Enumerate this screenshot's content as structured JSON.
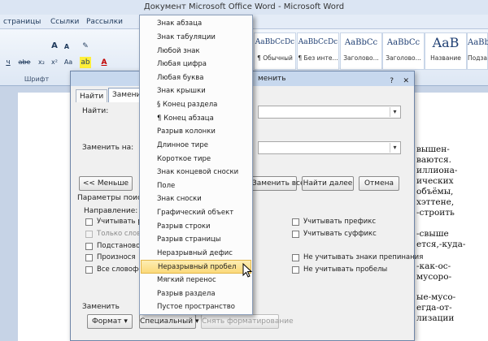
{
  "window": {
    "title": "Документ Microsoft Office Word - Microsoft Word"
  },
  "ribbon": {
    "tabs": [
      "страницы",
      "Ссылки",
      "Рассылки"
    ],
    "font_group_label": "Шрифт",
    "grow_font": "A",
    "shrink_font": "A",
    "strike": "abe",
    "subscript": "x₂",
    "superscript": "x²",
    "change_case": "Aa",
    "font_color": "A",
    "styles": [
      {
        "preview": "AaBbCcDc",
        "name": "¶ Обычный"
      },
      {
        "preview": "AaBbCcDc",
        "name": "¶ Без инте..."
      },
      {
        "preview": "AaBbCc",
        "name": "Заголово..."
      },
      {
        "preview": "AaBbCc",
        "name": "Заголово..."
      },
      {
        "preview": "AaB",
        "name": "Название"
      },
      {
        "preview": "AaBb",
        "name": "Подзаго"
      }
    ]
  },
  "document": {
    "lines": [
      "вышен-",
      "ваются.",
      "иллиона-",
      "ических",
      "объёмы,",
      "хэттене,",
      "-строить",
      "-свыше",
      "ется,-куда-",
      "-как-ос-",
      "мусоро-",
      "ые-мусо-",
      "егда-от-",
      "лизации"
    ]
  },
  "dialog": {
    "title": "менить",
    "help": "?",
    "close": "✕",
    "tabs": [
      "Найти",
      "Замени"
    ],
    "find_label": "Найти:",
    "replace_label": "Заменить на:",
    "less_button": "<< Меньше",
    "replace_all_button": "Заменить все",
    "find_next_button": "Найти далее",
    "cancel_button": "Отмена",
    "search_params_label": "Параметры поиска",
    "direction_label": "Направление:",
    "left_options": [
      {
        "label": "Учитывать р",
        "disabled": false
      },
      {
        "label": "Только слово",
        "disabled": true
      },
      {
        "label": "Подстановоч",
        "disabled": false
      },
      {
        "label": "Произнося",
        "disabled": false
      },
      {
        "label": "Все словофо",
        "disabled": false
      }
    ],
    "right_options": [
      {
        "label": "Учитывать префикс",
        "disabled": false
      },
      {
        "label": "Учитывать суффикс",
        "disabled": false
      },
      {
        "label": "Не учитывать знаки препинания",
        "disabled": false
      },
      {
        "label": "Не учитывать пробелы",
        "disabled": false
      }
    ],
    "replace_section_label": "Заменить",
    "format_button": "Формат",
    "special_button": "Специальный",
    "no_format_button": "Снять форматирование"
  },
  "menu": {
    "items": [
      "Знак абзаца",
      "Знак табуляции",
      "Любой знак",
      "Любая цифра",
      "Любая буква",
      "Знак крышки",
      "§ Конец раздела",
      "¶ Конец абзаца",
      "Разрыв колонки",
      "Длинное тире",
      "Короткое тире",
      "Знак концевой сноски",
      "Поле",
      "Знак сноски",
      "Графический объект",
      "Разрыв строки",
      "Разрыв страницы",
      "Неразрывный дефис",
      "Неразрывный пробел",
      "Мягкий перенос",
      "Разрыв раздела",
      "Пустое пространство"
    ],
    "highlighted": "Неразрывный пробел"
  }
}
